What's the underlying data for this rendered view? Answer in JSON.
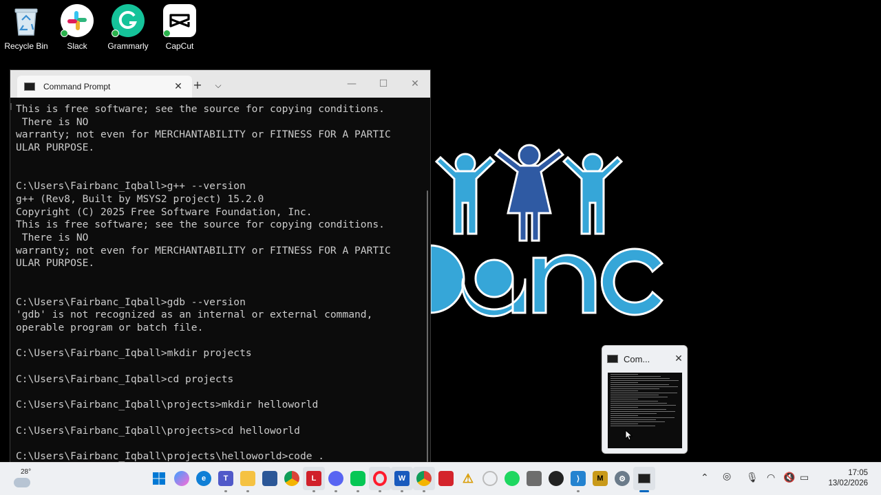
{
  "desktop_icons": [
    {
      "label": "Recycle Bin",
      "icon": "recycle-bin-icon"
    },
    {
      "label": "Slack",
      "icon": "slack-icon"
    },
    {
      "label": "Grammarly",
      "icon": "grammarly-icon"
    },
    {
      "label": "CapCut",
      "icon": "capcut-icon"
    }
  ],
  "terminal": {
    "tab_title": "Command Prompt",
    "lines": [
      "This is free software; see the source for copying conditions.",
      " There is NO",
      "warranty; not even for MERCHANTABILITY or FITNESS FOR A PARTIC",
      "ULAR PURPOSE.",
      "",
      "",
      "C:\\Users\\Fairbanc_Iqball>g++ --version",
      "g++ (Rev8, Built by MSYS2 project) 15.2.0",
      "Copyright (C) 2025 Free Software Foundation, Inc.",
      "This is free software; see the source for copying conditions.",
      " There is NO",
      "warranty; not even for MERCHANTABILITY or FITNESS FOR A PARTIC",
      "ULAR PURPOSE.",
      "",
      "",
      "C:\\Users\\Fairbanc_Iqball>gdb --version",
      "'gdb' is not recognized as an internal or external command,",
      "operable program or batch file.",
      "",
      "C:\\Users\\Fairbanc_Iqball>mkdir projects",
      "",
      "C:\\Users\\Fairbanc_Iqball>cd projects",
      "",
      "C:\\Users\\Fairbanc_Iqball\\projects>mkdir helloworld",
      "",
      "C:\\Users\\Fairbanc_Iqball\\projects>cd helloworld",
      "",
      "C:\\Users\\Fairbanc_Iqball\\projects\\helloworld>code ."
    ]
  },
  "preview": {
    "title": "Com..."
  },
  "taskbar": {
    "weather_temp": "28°",
    "time": "17:05",
    "date": "13/02/2026"
  },
  "colors": {
    "logo_light_blue": "#36a6d8",
    "logo_dark_blue": "#2f5aa3",
    "taskbar_accent": "#0067c0"
  }
}
